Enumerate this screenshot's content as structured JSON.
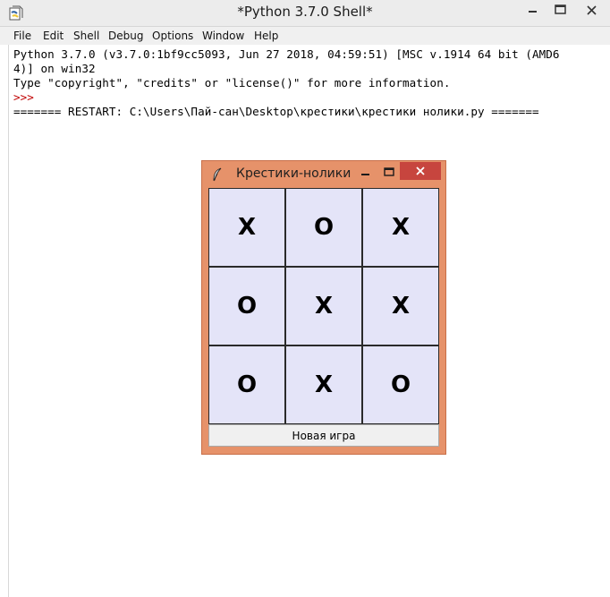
{
  "shell": {
    "title": "*Python 3.7.0 Shell*",
    "menu": [
      "File",
      "Edit",
      "Shell",
      "Debug",
      "Options",
      "Window",
      "Help"
    ],
    "output_lines": [
      "Python 3.7.0 (v3.7.0:1bf9cc5093, Jun 27 2018, 04:59:51) [MSC v.1914 64 bit (AMD6",
      "4)] on win32",
      "Type \"copyright\", \"credits\" or \"license()\" for more information."
    ],
    "prompt": ">>>",
    "restart_line": "======= RESTART: C:\\Users\\Пай-сан\\Desktop\\крестики\\крестики нолики.py ======="
  },
  "tk_window": {
    "title": "Крестики-нолики",
    "board": [
      "X",
      "O",
      "X",
      "O",
      "X",
      "X",
      "O",
      "X",
      "O"
    ],
    "new_game_label": "Новая игра"
  },
  "colors": {
    "tk_frame": "#e6926a",
    "tk_close": "#c7453e",
    "cell_bg": "#e4e4f8",
    "prompt": "#c00000"
  }
}
